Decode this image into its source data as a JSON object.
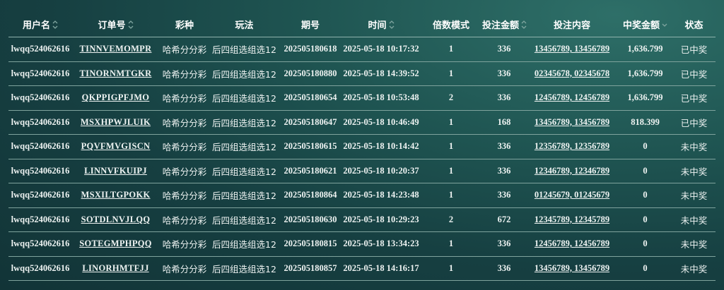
{
  "table": {
    "columns": [
      {
        "label": "用户名",
        "sortable": true,
        "sort_icon": "sort-updown-icon"
      },
      {
        "label": "订单号",
        "sortable": true,
        "sort_icon": "sort-updown-icon"
      },
      {
        "label": "彩种",
        "sortable": false
      },
      {
        "label": "玩法",
        "sortable": false
      },
      {
        "label": "期号",
        "sortable": false
      },
      {
        "label": "时间",
        "sortable": true,
        "sort_icon": "sort-updown-icon"
      },
      {
        "label": "倍数模式",
        "sortable": false
      },
      {
        "label": "投注金额",
        "sortable": true,
        "sort_icon": "sort-updown-icon"
      },
      {
        "label": "投注内容",
        "sortable": false
      },
      {
        "label": "中奖金额",
        "sortable": true,
        "sort_icon": "sort-down-icon"
      },
      {
        "label": "状态",
        "sortable": false
      }
    ],
    "rows": [
      {
        "user": "lwqq524062616",
        "order": "TINNVEMOMPR",
        "lottery": "哈希分分彩",
        "play": "后四组选组选12",
        "issue": "202505180618",
        "time": "2025-05-18 10:17:32",
        "multiplier": "1",
        "bet_amount": "336",
        "bet_content": "13456789, 13456789",
        "win_amount": "1,636.799",
        "status": "已中奖"
      },
      {
        "user": "lwqq524062616",
        "order": "TINORNMTGKR",
        "lottery": "哈希分分彩",
        "play": "后四组选组选12",
        "issue": "202505180880",
        "time": "2025-05-18 14:39:52",
        "multiplier": "1",
        "bet_amount": "336",
        "bet_content": "02345678, 02345678",
        "win_amount": "1,636.799",
        "status": "已中奖"
      },
      {
        "user": "lwqq524062616",
        "order": "QKPPIGPFJMO",
        "lottery": "哈希分分彩",
        "play": "后四组选组选12",
        "issue": "202505180654",
        "time": "2025-05-18 10:53:48",
        "multiplier": "2",
        "bet_amount": "336",
        "bet_content": "12456789, 12456789",
        "win_amount": "1,636.799",
        "status": "已中奖"
      },
      {
        "user": "lwqq524062616",
        "order": "MSXHPWJLUIK",
        "lottery": "哈希分分彩",
        "play": "后四组选组选12",
        "issue": "202505180647",
        "time": "2025-05-18 10:46:49",
        "multiplier": "1",
        "bet_amount": "168",
        "bet_content": "13456789, 13456789",
        "win_amount": "818.399",
        "status": "已中奖"
      },
      {
        "user": "lwqq524062616",
        "order": "PQVFMVGISCN",
        "lottery": "哈希分分彩",
        "play": "后四组选组选12",
        "issue": "202505180615",
        "time": "2025-05-18 10:14:42",
        "multiplier": "1",
        "bet_amount": "336",
        "bet_content": "12356789, 12356789",
        "win_amount": "0",
        "status": "未中奖"
      },
      {
        "user": "lwqq524062616",
        "order": "LINNVFKUIPJ",
        "lottery": "哈希分分彩",
        "play": "后四组选组选12",
        "issue": "202505180621",
        "time": "2025-05-18 10:20:37",
        "multiplier": "1",
        "bet_amount": "336",
        "bet_content": "12346789, 12346789",
        "win_amount": "0",
        "status": "未中奖"
      },
      {
        "user": "lwqq524062616",
        "order": "MSXILTGPOKK",
        "lottery": "哈希分分彩",
        "play": "后四组选组选12",
        "issue": "202505180864",
        "time": "2025-05-18 14:23:48",
        "multiplier": "1",
        "bet_amount": "336",
        "bet_content": "01245679, 01245679",
        "win_amount": "0",
        "status": "未中奖"
      },
      {
        "user": "lwqq524062616",
        "order": "SOTDLNVJLQQ",
        "lottery": "哈希分分彩",
        "play": "后四组选组选12",
        "issue": "202505180630",
        "time": "2025-05-18 10:29:23",
        "multiplier": "2",
        "bet_amount": "672",
        "bet_content": "12345789, 12345789",
        "win_amount": "0",
        "status": "未中奖"
      },
      {
        "user": "lwqq524062616",
        "order": "SOTEGMPHPQQ",
        "lottery": "哈希分分彩",
        "play": "后四组选组选12",
        "issue": "202505180815",
        "time": "2025-05-18 13:34:23",
        "multiplier": "1",
        "bet_amount": "336",
        "bet_content": "12456789, 12456789",
        "win_amount": "0",
        "status": "未中奖"
      },
      {
        "user": "lwqq524062616",
        "order": "LINORHMTFJJ",
        "lottery": "哈希分分彩",
        "play": "后四组选组选12",
        "issue": "202505180857",
        "time": "2025-05-18 14:16:17",
        "multiplier": "1",
        "bet_amount": "336",
        "bet_content": "13456789, 13456789",
        "win_amount": "0",
        "status": "未中奖"
      }
    ]
  },
  "colors": {
    "background_top": "#2e6f68",
    "background_bottom": "#123437",
    "text": "#eef3f2",
    "divider": "#7fa39d",
    "sort_icon": "#7fa59f"
  }
}
